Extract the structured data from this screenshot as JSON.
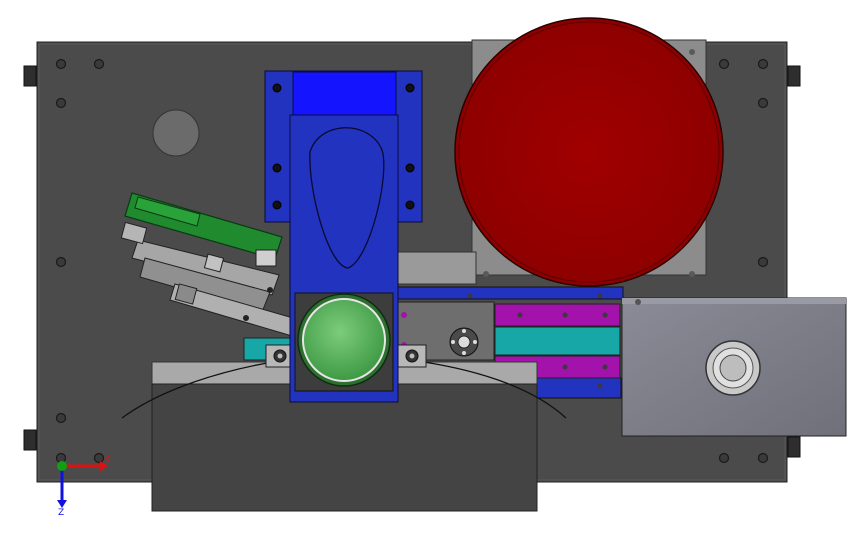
{
  "viewport": {
    "background": "#ffffff",
    "view": "top"
  },
  "model": {
    "colors": {
      "base_plate": "#4a4a4a",
      "base_plate_edge": "#2b2b2b",
      "blue_bracket": "#1f2fbf",
      "blue_bright": "#1010ff",
      "red_disc": "#9b0000",
      "green_button": "#54a857",
      "green_board": "#1f8a2e",
      "magenta_rail": "#a010a8",
      "teal_block": "#18a5a5",
      "gray_panel": "#7b7c86",
      "light_gray": "#a8a8a8",
      "dark_block": "#3d3d3d"
    }
  },
  "triad": {
    "x_label": "X",
    "z_label": "Z",
    "x_color": "#e01010",
    "z_color": "#1010e0",
    "y_color": "#10a010"
  }
}
